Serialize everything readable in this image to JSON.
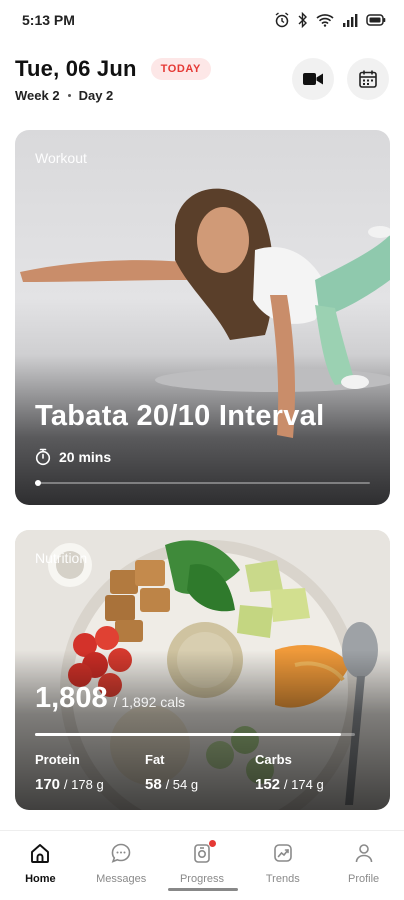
{
  "status_bar": {
    "time": "5:13 PM"
  },
  "header": {
    "date": "Tue, 06 Jun",
    "today_badge": "TODAY",
    "week": "Week 2",
    "day": "Day 2"
  },
  "workout": {
    "label": "Workout",
    "title": "Tabata 20/10 Interval",
    "duration": "20 mins",
    "progress": 0.01
  },
  "nutrition": {
    "label": "Nutrition",
    "calories": "1,808",
    "calories_goal": "/ 1,892 cals",
    "calories_fraction": 0.955,
    "macros": [
      {
        "name": "Protein",
        "value": "170",
        "goal": "/ 178 g"
      },
      {
        "name": "Fat",
        "value": "58",
        "goal": "/ 54 g"
      },
      {
        "name": "Carbs",
        "value": "152",
        "goal": "/ 174 g"
      }
    ]
  },
  "nav": [
    {
      "label": "Home",
      "icon": "home-icon",
      "active": true
    },
    {
      "label": "Messages",
      "icon": "chat-bubble-icon",
      "active": false
    },
    {
      "label": "Progress",
      "icon": "progress-icon",
      "active": false,
      "badge": true
    },
    {
      "label": "Trends",
      "icon": "trends-icon",
      "active": false
    },
    {
      "label": "Profile",
      "icon": "profile-icon",
      "active": false
    }
  ],
  "colors": {
    "accent_red": "#e53935",
    "badge_bg": "#fde7e7"
  }
}
